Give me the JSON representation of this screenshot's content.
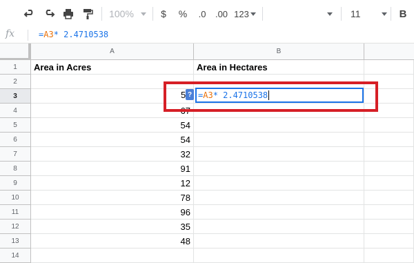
{
  "toolbar": {
    "zoom": "100%",
    "currency": "$",
    "percent": "%",
    "dec_decrease": ".0",
    "dec_increase": ".00",
    "format_more": "123",
    "font_size": "11",
    "bold": "B"
  },
  "formula_bar": {
    "fx_label": "fx",
    "prefix": "=",
    "ref": "A3",
    "rest": "* 2.4710538"
  },
  "columns": [
    "A",
    "B"
  ],
  "rows": [
    "1",
    "2",
    "3",
    "4",
    "5",
    "6",
    "7",
    "8",
    "9",
    "10",
    "11",
    "12",
    "13",
    "14"
  ],
  "cells": {
    "A1": "Area in Acres",
    "B1": "Area in Hectares",
    "A3": "5",
    "A4": "67",
    "A5": "54",
    "A6": "54",
    "A7": "32",
    "A8": "91",
    "A9": "12",
    "A10": "78",
    "A11": "96",
    "A12": "35",
    "A13": "48"
  },
  "editor": {
    "badge": "?",
    "prefix": "=",
    "ref": "A3",
    "rest": "* 2.4710538"
  },
  "colors": {
    "highlight": "#d61f26",
    "editor_border": "#1a73e8",
    "ref_color": "#e8710a"
  }
}
